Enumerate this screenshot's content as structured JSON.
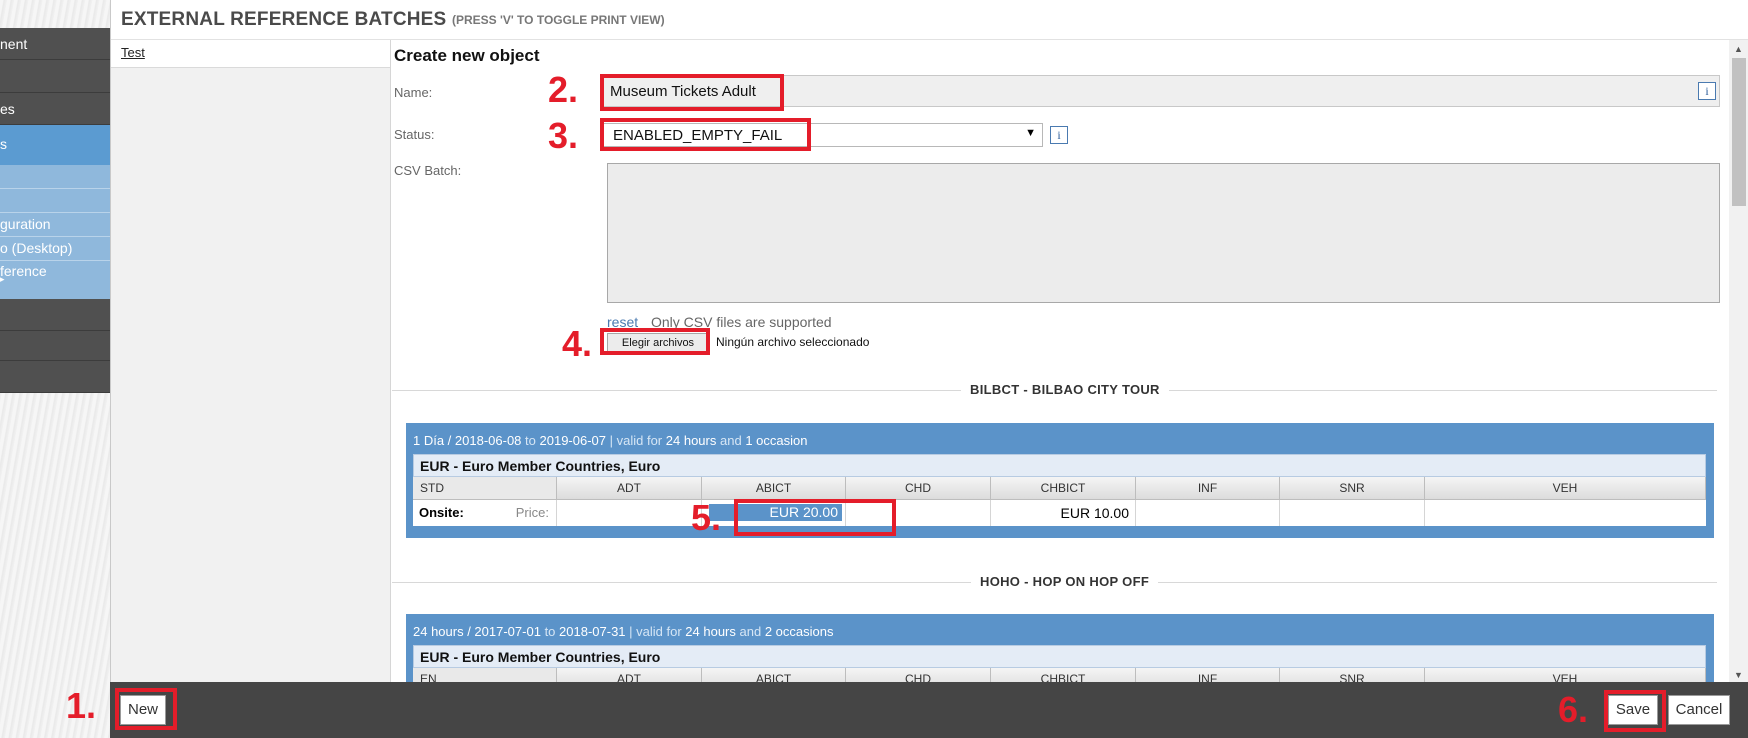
{
  "sidebar": {
    "items": [
      {
        "label": "nent"
      },
      {
        "label": ""
      },
      {
        "label": "es"
      },
      {
        "label": "s"
      },
      {
        "label": ""
      },
      {
        "label": ""
      },
      {
        "label": "guration"
      },
      {
        "label": "o (Desktop)"
      },
      {
        "label": "ference",
        "arrow": "▸"
      },
      {
        "label": ""
      },
      {
        "label": ""
      },
      {
        "label": ""
      }
    ]
  },
  "header": {
    "title": "EXTERNAL REFERENCE BATCHES",
    "subtitle": "(PRESS 'V' TO TOGGLE PRINT VIEW)"
  },
  "list": {
    "items": [
      {
        "label": "Test"
      }
    ]
  },
  "form": {
    "title": "Create new object",
    "name_label": "Name:",
    "name_value": "Museum Tickets Adult",
    "info_icon": "i",
    "status_label": "Status:",
    "status_value": "ENABLED_EMPTY_FAIL",
    "status_chevron": "▼",
    "csv_label": "CSV Batch:",
    "reset_link": "reset",
    "csv_note": "Only CSV files are supported",
    "file_button": "Elegir archivos",
    "file_none": "Ningún archivo seleccionado"
  },
  "sections": [
    {
      "title": "BILBCT - BILBAO CITY TOUR",
      "batch": {
        "date_from": "1 Día / 2018-06-08",
        "to_word": "to",
        "date_to": "2019-06-07",
        "valid_prefix": "| valid for",
        "duration": "24 hours",
        "and_word": "and",
        "occasions": "1 occasion",
        "currency": "EUR - Euro Member Countries, Euro",
        "columns": [
          "STD",
          "ADT",
          "ABICT",
          "CHD",
          "CHBICT",
          "INF",
          "SNR",
          "VEH"
        ],
        "row_label": "Onsite:",
        "price_label": "Price:",
        "abict_price": "EUR 20.00",
        "chbict_price": "EUR 10.00"
      }
    },
    {
      "title": "HOHO - HOP ON HOP OFF",
      "batch": {
        "date_from": "24 hours / 2017-07-01",
        "to_word": "to",
        "date_to": "2018-07-31",
        "valid_prefix": "| valid for",
        "duration": "24 hours",
        "and_word": "and",
        "occasions": "2 occasions",
        "currency": "EUR - Euro Member Countries, Euro",
        "columns": [
          "EN",
          "ADT",
          "ABICT",
          "CHD",
          "CHBICT",
          "INF",
          "SNR",
          "VEH"
        ]
      }
    }
  ],
  "footer": {
    "new_label": "New",
    "save_label": "Save",
    "cancel_label": "Cancel"
  },
  "annotations": {
    "n1": "1.",
    "n2": "2.",
    "n3": "3.",
    "n4": "4.",
    "n5": "5.",
    "n6": "6.",
    "color": "#e41d2a"
  },
  "colors": {
    "sidebar_dark": "#505050",
    "sidebar_selected": "#5b9bd1",
    "sidebar_sub": "#8fb8dc",
    "batch_blue": "#5b93c9",
    "footer": "#454545"
  }
}
